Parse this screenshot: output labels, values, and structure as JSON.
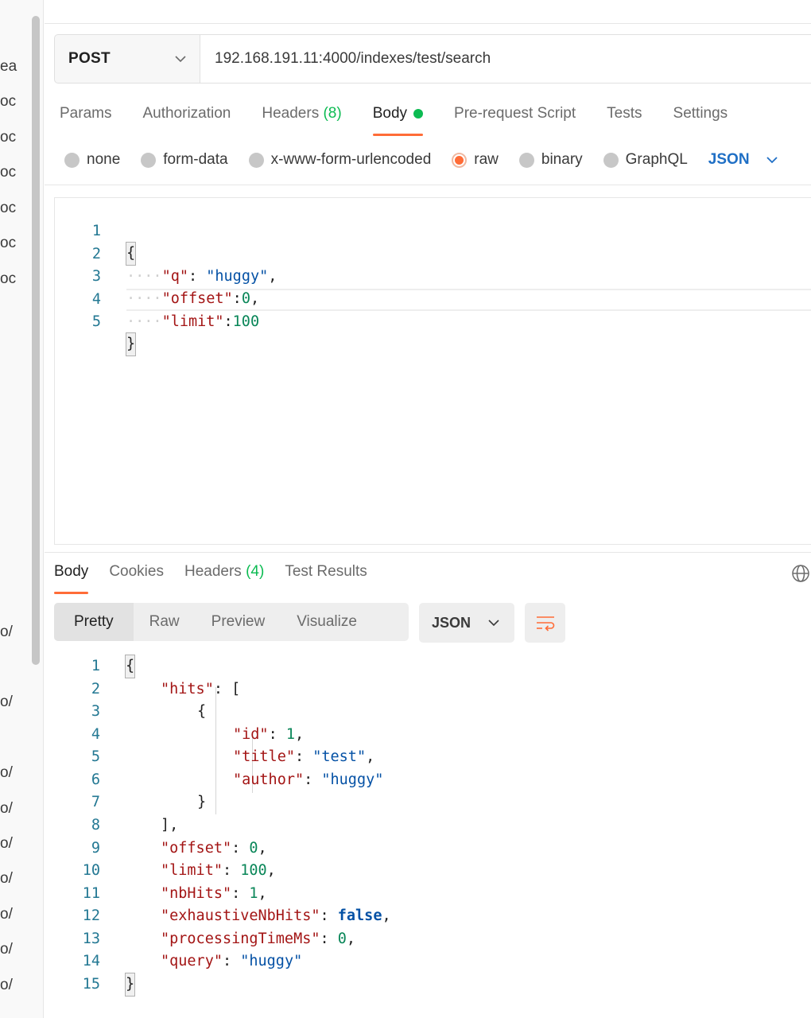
{
  "sidebar": {
    "fragments": [
      "ea",
      "oc",
      "oc",
      "oc",
      "oc",
      "oc",
      "oc",
      "o/",
      "o/",
      "o/",
      "o/",
      "o/",
      "o/",
      "o/",
      "o/",
      "o/"
    ]
  },
  "request": {
    "method": "POST",
    "url": "192.168.191.11:4000/indexes/test/search",
    "tabs": [
      {
        "label": "Params"
      },
      {
        "label": "Authorization"
      },
      {
        "label": "Headers",
        "count": "(8)"
      },
      {
        "label": "Body",
        "active": true
      },
      {
        "label": "Pre-request Script"
      },
      {
        "label": "Tests"
      },
      {
        "label": "Settings"
      }
    ],
    "body_types": [
      "none",
      "form-data",
      "x-www-form-urlencoded",
      "raw",
      "binary",
      "GraphQL"
    ],
    "selected_body_type": "raw",
    "format": "JSON",
    "body_lines": [
      {
        "n": "1",
        "text": "{"
      },
      {
        "n": "2",
        "key": "\"q\"",
        "sep": ": ",
        "val": "\"huggy\"",
        "tail": ","
      },
      {
        "n": "3",
        "key": "\"offset\"",
        "sep": ":",
        "val": "0",
        "tail": ","
      },
      {
        "n": "4",
        "key": "\"limit\"",
        "sep": ":",
        "val": "100",
        "tail": ""
      },
      {
        "n": "5",
        "text": "}"
      }
    ]
  },
  "response": {
    "tabs": [
      {
        "label": "Body",
        "active": true
      },
      {
        "label": "Cookies"
      },
      {
        "label": "Headers",
        "count": "(4)"
      },
      {
        "label": "Test Results"
      }
    ],
    "views": [
      "Pretty",
      "Raw",
      "Preview",
      "Visualize"
    ],
    "active_view": "Pretty",
    "format": "JSON",
    "lines": [
      {
        "n": "1",
        "p1": "{"
      },
      {
        "n": "2",
        "k": "\"hits\"",
        "p1": ": ["
      },
      {
        "n": "3",
        "p1": "{"
      },
      {
        "n": "4",
        "k": "\"id\"",
        "p1": ": ",
        "v": "1",
        "p2": ","
      },
      {
        "n": "5",
        "k": "\"title\"",
        "p1": ": ",
        "v": "\"test\"",
        "p2": ","
      },
      {
        "n": "6",
        "k": "\"author\"",
        "p1": ": ",
        "v": "\"huggy\""
      },
      {
        "n": "7",
        "p1": "}"
      },
      {
        "n": "8",
        "p1": "],"
      },
      {
        "n": "9",
        "k": "\"offset\"",
        "p1": ": ",
        "v": "0",
        "p2": ","
      },
      {
        "n": "10",
        "k": "\"limit\"",
        "p1": ": ",
        "v": "100",
        "p2": ","
      },
      {
        "n": "11",
        "k": "\"nbHits\"",
        "p1": ": ",
        "v": "1",
        "p2": ","
      },
      {
        "n": "12",
        "k": "\"exhaustiveNbHits\"",
        "p1": ": ",
        "v": "false",
        "p2": ","
      },
      {
        "n": "13",
        "k": "\"processingTimeMs\"",
        "p1": ": ",
        "v": "0",
        "p2": ","
      },
      {
        "n": "14",
        "k": "\"query\"",
        "p1": ": ",
        "v": "\"huggy\""
      },
      {
        "n": "15",
        "p1": "}"
      }
    ]
  }
}
